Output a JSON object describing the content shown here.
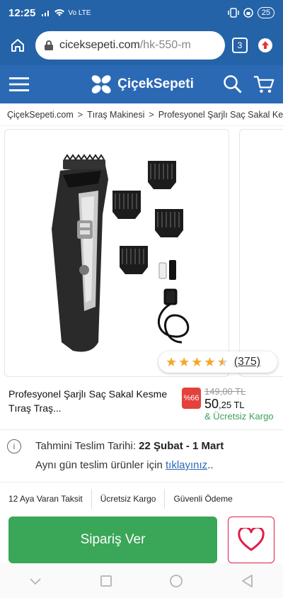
{
  "status_bar": {
    "time": "12:25",
    "network": "Vo LTE",
    "battery": "25"
  },
  "browser": {
    "url_domain": "ciceksepeti.com",
    "url_path": "/hk-550-m",
    "tab_count": "3",
    "icons": [
      "home-icon",
      "lock-icon",
      "tabs-icon",
      "update-icon"
    ]
  },
  "header": {
    "brand": "ÇiçekSepeti",
    "icons": [
      "menu-icon",
      "flower-logo-icon",
      "search-icon",
      "cart-icon"
    ]
  },
  "breadcrumb": {
    "items": [
      "ÇiçekSepeti.com",
      "Tıraş Makinesi",
      "Profesyonel Şarjlı Saç Sakal Ke"
    ],
    "separator": ">"
  },
  "product": {
    "name": "Profesyonel Şarjlı Saç Sakal Kesme Tıraş Traş...",
    "rating": 4.5,
    "rating_count": "(375)",
    "discount": "%66",
    "old_price": "149,00 TL",
    "price_main": "50",
    "price_cents": ",25 TL",
    "free_shipping": "& Ücretsiz Kargo"
  },
  "delivery": {
    "label": "Tahmini Teslim Tarihi:",
    "dates": "22 Şubat - 1 Mart",
    "same_day_text": "Aynı gün teslim ürünler için",
    "same_day_link": "tıklayınız",
    "same_day_suffix": ".."
  },
  "features": [
    "12 Aya Varan Taksit",
    "Ücretsiz Kargo",
    "Güvenli Ödeme"
  ],
  "actions": {
    "order_label": "Sipariş Ver"
  },
  "colors": {
    "brand_blue": "#2b69b5",
    "order_green": "#3aa657",
    "discount_red": "#e4413b",
    "star": "#f5a623"
  }
}
